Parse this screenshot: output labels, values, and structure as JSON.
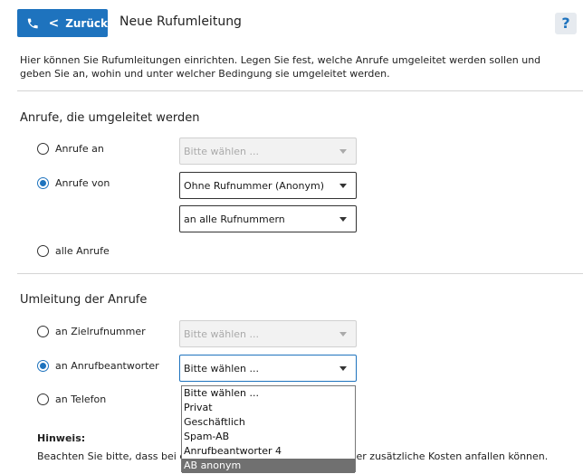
{
  "header": {
    "back_label": "Zurück",
    "title": "Neue Rufumleitung",
    "help": "?"
  },
  "intro": "Hier können Sie Rufumleitungen einrichten. Legen Sie fest, welche Anrufe umgeleitet werden sollen und geben Sie an, wohin und unter welcher Bedingung sie umgeleitet werden.",
  "section1": {
    "title": "Anrufe, die umgeleitet werden",
    "options": [
      {
        "label": "Anrufe an",
        "checked": false
      },
      {
        "label": "Anrufe von",
        "checked": true
      },
      {
        "label": "alle Anrufe",
        "checked": false
      }
    ],
    "select_anrufe_an": "Bitte wählen ...",
    "select_anrufe_von": "Ohne Rufnummer (Anonym)",
    "select_rufnummern": "an alle Rufnummern"
  },
  "section2": {
    "title": "Umleitung der Anrufe",
    "options": [
      {
        "label": "an Zielrufnummer",
        "checked": false
      },
      {
        "label": "an Anrufbeantworter",
        "checked": true
      },
      {
        "label": "an Telefon",
        "checked": false
      }
    ],
    "select_ziel": "Bitte wählen ...",
    "select_ab": "Bitte wählen ...",
    "dropdown_options": [
      "Bitte wählen ...",
      "Privat",
      "Geschäftlich",
      "Spam-AB",
      "Anrufbeantworter 4",
      "AB anonym"
    ],
    "dropdown_highlighted": "AB anonym"
  },
  "hint": {
    "title": "Hinweis:",
    "text_start": "Beachten Sie bitte, dass bei de",
    "text_end": "mmer zusätzliche Kosten anfallen können."
  },
  "colors": {
    "accent": "#1e73be",
    "highlight": "#707070"
  }
}
